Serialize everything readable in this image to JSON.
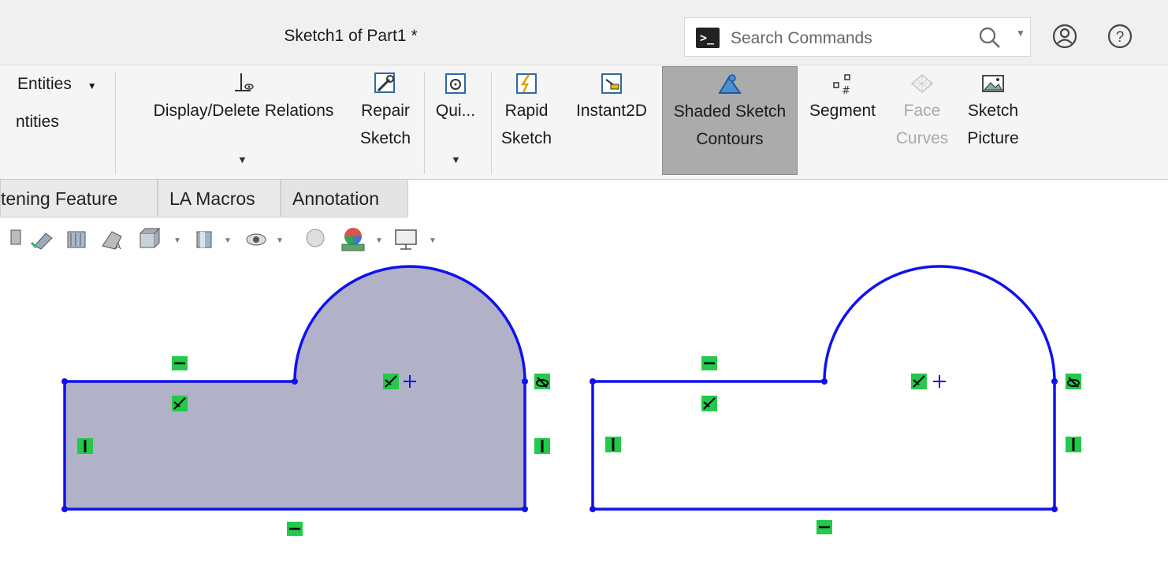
{
  "titlebar": {
    "title": "Sketch1 of Part1 *",
    "search_placeholder": "Search Commands",
    "icons": [
      "command-prompt-icon",
      "search-icon",
      "user-icon",
      "help-icon"
    ]
  },
  "ribbon": {
    "left_group": {
      "item1": "Entities",
      "item2": "ntities"
    },
    "buttons": {
      "display_delete": "Display/Delete Relations",
      "repair": [
        "Repair",
        "Sketch"
      ],
      "quick": "Qui...",
      "rapid": [
        "Rapid",
        "Sketch"
      ],
      "instant2d": "Instant2D",
      "shaded": [
        "Shaded Sketch",
        "Contours"
      ],
      "segment": "Segment",
      "face_curves": [
        "Face",
        "Curves"
      ],
      "sketch_picture": [
        "Sketch",
        "Picture"
      ]
    }
  },
  "tabs": [
    "tening Feature",
    "LA Macros",
    "Annotation"
  ],
  "colors": {
    "sketch_line": "#1010f0",
    "shaded_fill": "#b1b2c8",
    "relation_badge": "#22c94a",
    "active_button": "#ababab"
  }
}
